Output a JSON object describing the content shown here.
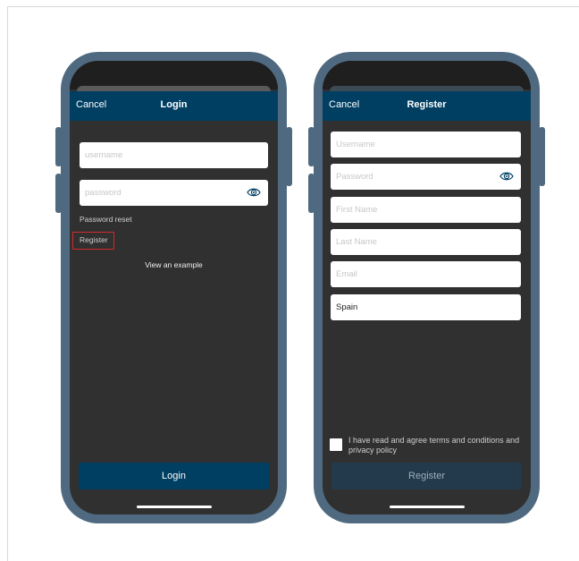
{
  "login_screen": {
    "nav": {
      "cancel": "Cancel",
      "title": "Login"
    },
    "username_placeholder": "username",
    "password_placeholder": "password",
    "password_reset": "Password reset",
    "register_link": "Register",
    "view_example": "View an example",
    "login_button": "Login",
    "colors": {
      "navbar": "#003f62",
      "button": "#003f62",
      "highlight": "#d42a2a"
    }
  },
  "register_screen": {
    "nav": {
      "cancel": "Cancel",
      "title": "Register"
    },
    "fields": {
      "username_placeholder": "Username",
      "password_placeholder": "Password",
      "first_name_placeholder": "First Name",
      "last_name_placeholder": "Last Name",
      "email_placeholder": "Email",
      "country_value": "Spain"
    },
    "terms_text": "I have read and agree terms and conditions and privacy policy",
    "register_button": "Register",
    "colors": {
      "navbar": "#003f62",
      "button_disabled": "#223a4c"
    }
  },
  "icons": {
    "show_password": "eye-icon"
  }
}
